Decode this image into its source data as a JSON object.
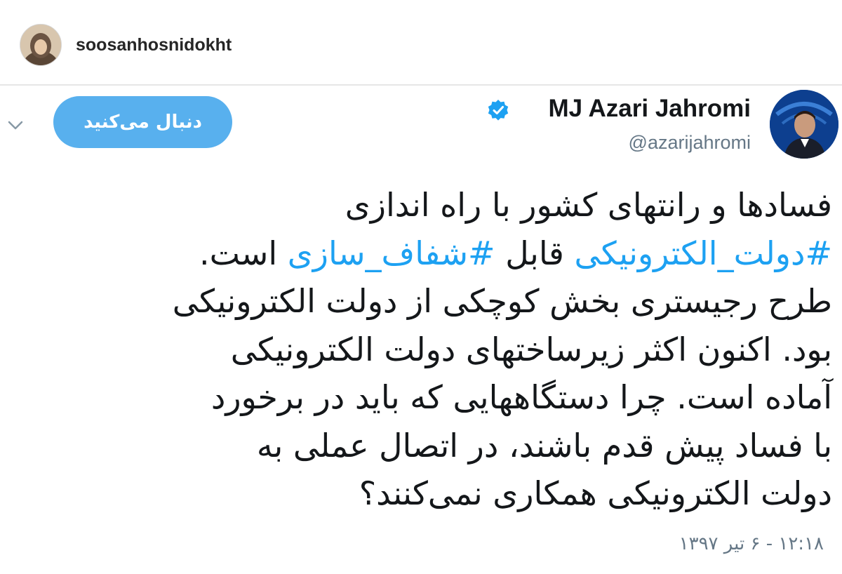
{
  "instagram": {
    "username": "soosanhosnidokht"
  },
  "tweet": {
    "follow_label": "دنبال می‌کنید",
    "author_name": "MJ Azari Jahromi",
    "author_handle": "@azarijahromi",
    "lines": [
      [
        {
          "text": "فسادها و رانتهای کشور با راه اندازی"
        }
      ],
      [
        {
          "text": "#دولت_الکترونیکی",
          "hashtag": true
        },
        {
          "text": " قابل "
        },
        {
          "text": "#شفاف_سازی",
          "hashtag": true
        },
        {
          "text": " است."
        }
      ],
      [
        {
          "text": "طرح رجیستری بخش کوچکی از دولت الکترونیکی"
        }
      ],
      [
        {
          "text": "بود. اکنون اکثر زیرساختهای دولت الکترونیکی"
        }
      ],
      [
        {
          "text": "آماده است. چرا دستگاههایی که باید در برخورد"
        }
      ],
      [
        {
          "text": "با فساد پیش قدم باشند، در اتصال عملی به"
        }
      ],
      [
        {
          "text": "دولت الکترونیکی همکاری نمی‌کنند؟"
        }
      ]
    ],
    "timestamp": "۱۲:۱۸ - ۶ تیر ۱۳۹۷",
    "hashtag_color": "#1da1f2",
    "follow_button_color": "#58b0ee",
    "verified_color": "#1da1f2"
  },
  "icons": {
    "verified": "verified-badge-icon",
    "chevron": "chevron-down-icon"
  }
}
